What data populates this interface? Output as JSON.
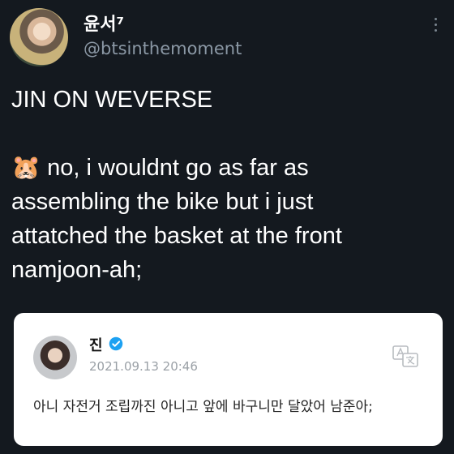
{
  "profile": {
    "display_name": "윤서⁷",
    "handle": "@btsinthemoment"
  },
  "tweet": {
    "text": "JIN ON WEVERSE\n\n🐹 no, i wouldnt go as far as\nassembling the bike but i just\nattatched the basket at the front\nnamjoon-ah;"
  },
  "embed": {
    "name": "진",
    "timestamp": "2021.09.13 20:46",
    "text": "아니 자전거 조립까진 아니고 앞에 바구니만 달았어 남준아;"
  },
  "colors": {
    "background": "#14191f",
    "handle": "#8b98a5",
    "verified": "#1da1f2"
  },
  "icons": [
    "more-vertical-icon",
    "verified-icon",
    "translate-icon"
  ]
}
